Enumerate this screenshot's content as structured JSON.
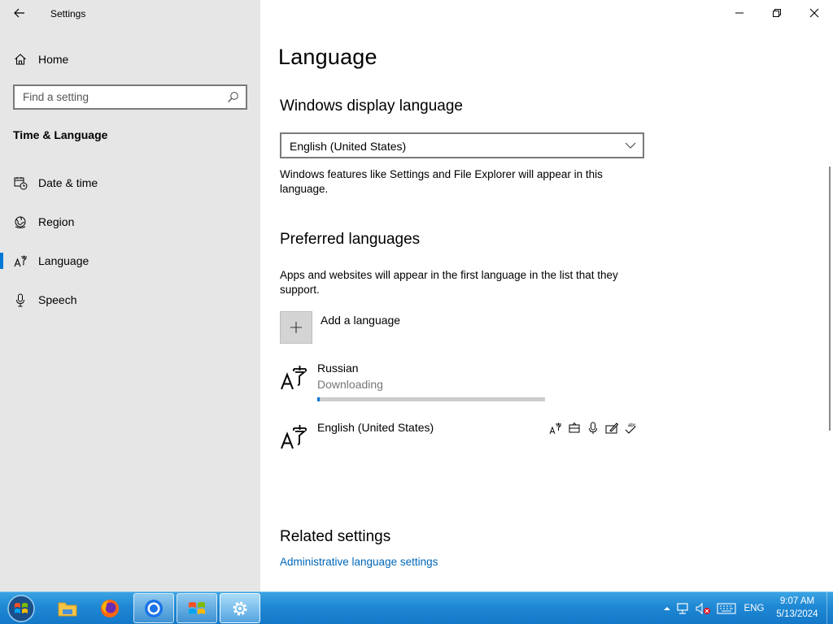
{
  "app": {
    "title": "Settings"
  },
  "sidebar": {
    "home_label": "Home",
    "search_placeholder": "Find a setting",
    "section_title": "Time & Language",
    "items": [
      {
        "label": "Date & time",
        "icon": "calendar-clock-icon"
      },
      {
        "label": "Region",
        "icon": "globe-icon"
      },
      {
        "label": "Language",
        "icon": "language-icon",
        "active": true
      },
      {
        "label": "Speech",
        "icon": "microphone-icon"
      }
    ]
  },
  "main": {
    "page_title": "Language",
    "display_language": {
      "heading": "Windows display language",
      "selected": "English (United States)",
      "description": "Windows features like Settings and File Explorer will appear in this language."
    },
    "preferred": {
      "heading": "Preferred languages",
      "description": "Apps and websites will appear in the first language in the list that they support.",
      "add_label": "Add a language",
      "languages": [
        {
          "name": "Russian",
          "status": "Downloading",
          "progress": 0.01
        },
        {
          "name": "English (United States)",
          "features": [
            "language-pack-icon",
            "display-language-icon",
            "speech-icon",
            "handwriting-icon",
            "spell-check-icon"
          ]
        }
      ]
    },
    "related": {
      "heading": "Related settings",
      "links": [
        "Administrative language settings"
      ]
    }
  },
  "taskbar": {
    "apps": [
      "file-explorer",
      "firefox",
      "chrome",
      "windows",
      "settings"
    ],
    "input_language": "ENG",
    "time": "9:07 AM",
    "date": "5/13/2024"
  },
  "colors": {
    "accent": "#0078d7",
    "link": "#0067b8",
    "sidebar_bg": "#e6e6e6"
  }
}
